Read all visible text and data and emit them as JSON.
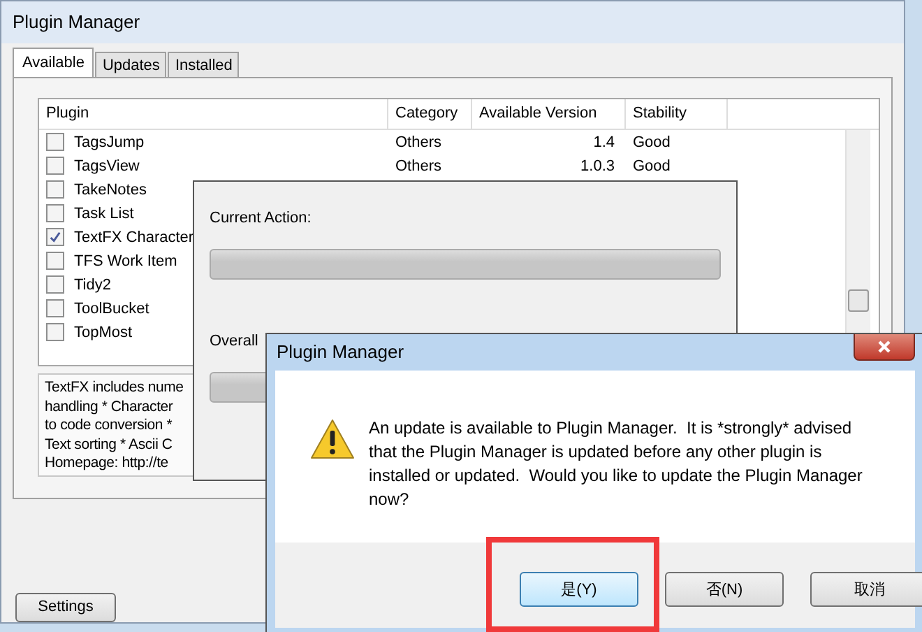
{
  "window": {
    "title": "Plugin Manager"
  },
  "tabs": [
    {
      "label": "Available",
      "selected": true
    },
    {
      "label": "Updates",
      "selected": false
    },
    {
      "label": "Installed",
      "selected": false
    }
  ],
  "table": {
    "columns": [
      "Plugin",
      "Category",
      "Available Version",
      "Stability"
    ],
    "rows": [
      {
        "name": "TagsJump",
        "checked": false,
        "category": "Others",
        "version": "1.4",
        "stability": "Good"
      },
      {
        "name": "TagsView",
        "checked": false,
        "category": "Others",
        "version": "1.0.3",
        "stability": "Good"
      },
      {
        "name": "TakeNotes",
        "checked": false
      },
      {
        "name": "Task List",
        "checked": false
      },
      {
        "name": "TextFX Character",
        "checked": true
      },
      {
        "name": "TFS Work Item",
        "checked": false
      },
      {
        "name": "Tidy2",
        "checked": false
      },
      {
        "name": "ToolBucket",
        "checked": false
      },
      {
        "name": "TopMost",
        "checked": false
      }
    ]
  },
  "description": [
    "TextFX includes nume",
    "handling * Character",
    "to code conversion *",
    "Text sorting * Ascii C",
    "Homepage: http://te"
  ],
  "settings_button": "Settings",
  "progress_window": {
    "current": {
      "label": "Current Action:",
      "level": 0
    },
    "overall": {
      "label": "Overall",
      "level": 0
    }
  },
  "dialog": {
    "title": "Plugin Manager",
    "message": "An update is available to Plugin Manager.  It is *strongly* advised that the Plugin Manager is updated before any other plugin is installed or updated.  Would you like to update the Plugin Manager now?",
    "buttons": [
      {
        "label": "是(Y)",
        "highlighted": true
      },
      {
        "label": "否(N)",
        "highlighted": false
      },
      {
        "label": "取消",
        "highlighted": false
      }
    ]
  }
}
